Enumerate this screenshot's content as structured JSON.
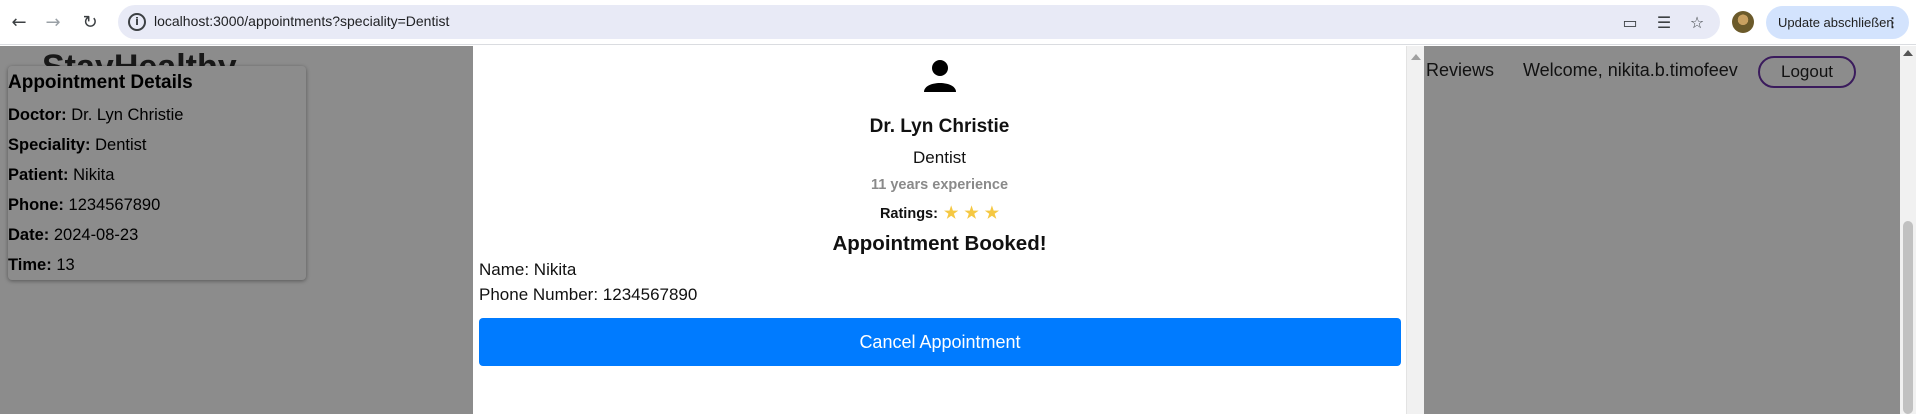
{
  "browser": {
    "url": "localhost:3000/appointments?speciality=Dentist",
    "update_button": "Update abschließen"
  },
  "site": {
    "brand": "StayHealthy",
    "nav_reviews": "Reviews",
    "welcome": "Welcome, nikita.b.timofeev",
    "logout": "Logout"
  },
  "details": {
    "title": "Appointment Details",
    "rows": [
      {
        "label": "Doctor:",
        "value": "Dr. Lyn Christie"
      },
      {
        "label": "Speciality:",
        "value": "Dentist"
      },
      {
        "label": "Patient:",
        "value": "Nikita"
      },
      {
        "label": "Phone:",
        "value": "1234567890"
      },
      {
        "label": "Date:",
        "value": "2024-08-23"
      },
      {
        "label": "Time:",
        "value": "13"
      }
    ]
  },
  "modal": {
    "doctor_name": "Dr. Lyn Christie",
    "speciality": "Dentist",
    "experience": "11 years experience",
    "ratings_label": "Ratings:",
    "stars": 3,
    "booked": "Appointment Booked!",
    "name_line": "Name: Nikita",
    "phone_line": "Phone Number: 1234567890",
    "cancel_button": "Cancel Appointment"
  },
  "colors": {
    "primary_button": "#007bff",
    "star": "#f5c842",
    "logout_border": "#6a32a8"
  }
}
